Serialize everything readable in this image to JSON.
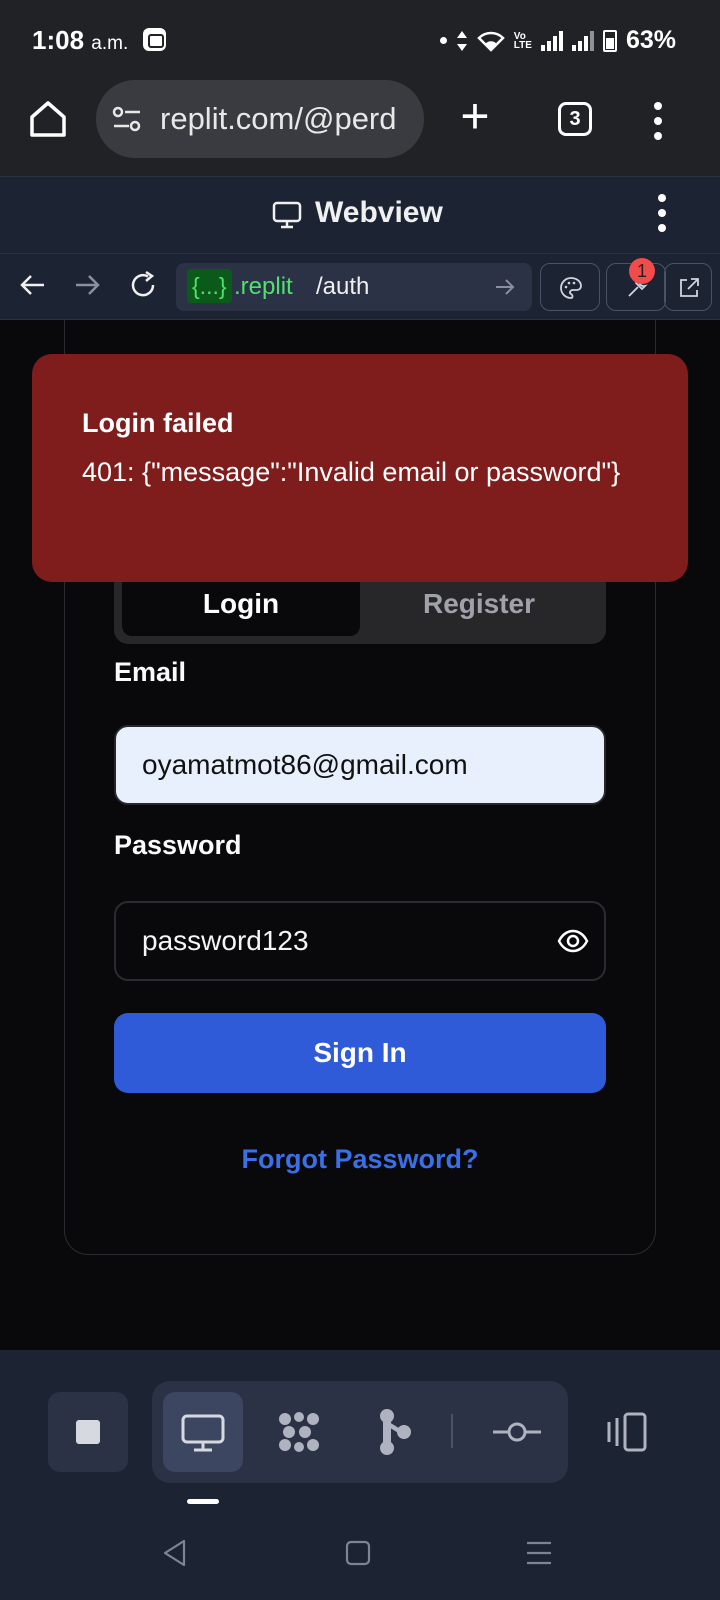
{
  "status_bar": {
    "time": "1:08",
    "ampm": "a.m.",
    "battery": "63%"
  },
  "browser": {
    "url": "replit.com/@perd",
    "tab_count": "3"
  },
  "webview": {
    "title": "Webview",
    "address": {
      "brace": "{...}",
      "domain": ".replit",
      "path": "/auth"
    },
    "devtools_badge": "1"
  },
  "toast": {
    "title": "Login failed",
    "message": "401: {\"message\":\"Invalid email or password\"}"
  },
  "auth": {
    "tabs": [
      "Login",
      "Register"
    ],
    "email_label": "Email",
    "email_value": "oyamatmot86@gmail.com",
    "password_label": "Password",
    "password_value": "password123",
    "sign_in_label": "Sign In",
    "forgot_label": "Forgot Password?"
  },
  "colors": {
    "toast_bg": "#7f1d1d",
    "primary": "#2f5bd8",
    "link": "#3b6fe6",
    "page_bg": "#09090b",
    "chrome_bg": "#1c2333"
  }
}
